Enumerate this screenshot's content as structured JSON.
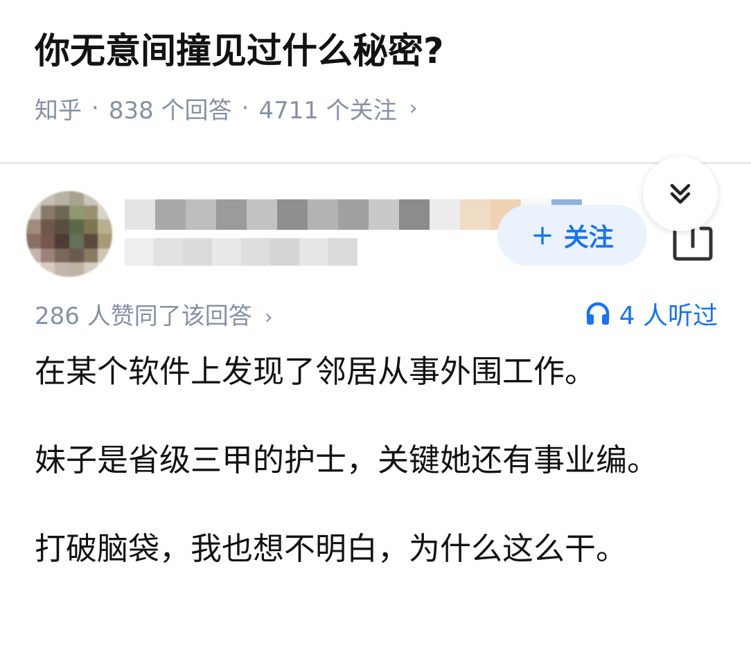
{
  "question": {
    "title": "你无意间撞见过什么秘密?",
    "source": "知乎",
    "separator": "·",
    "answers": "838 个回答",
    "followers": "4711 个关注",
    "chevron": "›"
  },
  "author": {
    "follow_label": "关注",
    "follow_icon": "plus-icon"
  },
  "toolbar": {
    "collapse_icon": "double-chevron-down-icon",
    "share_icon": "share-icon"
  },
  "answer": {
    "votes_text": "286 人赞同了该回答",
    "chevron": "›",
    "listeners": "4 人听过",
    "paragraphs": [
      "在某个软件上发现了邻居从事外围工作。",
      "妹子是省级三甲的护士，关键她还有事业编。",
      "打破脑袋，我也想不明白，为什么这么干。"
    ]
  },
  "colors": {
    "accent": "#1772f6",
    "muted": "#8590a6",
    "text": "#121212",
    "follow_bg": "#eaf2fd"
  }
}
